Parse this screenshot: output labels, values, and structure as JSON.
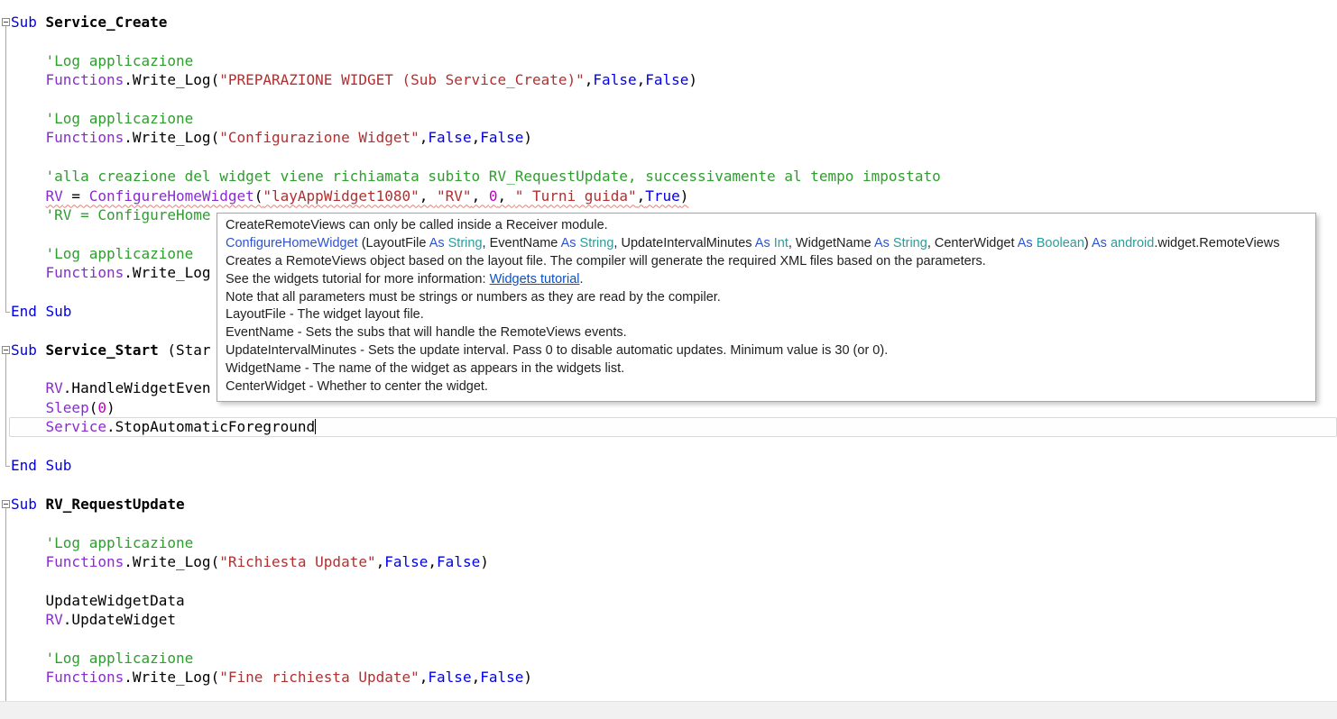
{
  "editor": {
    "syntax_colors": {
      "keyword": "#0000e8",
      "module": "#8a2bd2",
      "string": "#b03030",
      "comment": "#2e9e2e",
      "number": "#c000c0",
      "plain": "#000000",
      "squiggle": "#e97e72"
    },
    "lines": [
      {
        "segments": [
          {
            "t": "Sub ",
            "s": "k"
          },
          {
            "t": "Service_Create",
            "s": "b"
          }
        ]
      },
      {
        "segments": []
      },
      {
        "segments": [
          {
            "t": "    ",
            "s": "p"
          },
          {
            "t": "'Log applicazione",
            "s": "c"
          }
        ]
      },
      {
        "segments": [
          {
            "t": "    ",
            "s": "p"
          },
          {
            "t": "Functions",
            "s": "m"
          },
          {
            "t": ".Write_Log(",
            "s": "p"
          },
          {
            "t": "\"PREPARAZIONE WIDGET (Sub Service_Create)\"",
            "s": "s"
          },
          {
            "t": ",",
            "s": "p"
          },
          {
            "t": "False",
            "s": "k"
          },
          {
            "t": ",",
            "s": "p"
          },
          {
            "t": "False",
            "s": "k"
          },
          {
            "t": ")",
            "s": "p"
          }
        ]
      },
      {
        "segments": []
      },
      {
        "segments": [
          {
            "t": "    ",
            "s": "p"
          },
          {
            "t": "'Log applicazione",
            "s": "c"
          }
        ]
      },
      {
        "segments": [
          {
            "t": "    ",
            "s": "p"
          },
          {
            "t": "Functions",
            "s": "m"
          },
          {
            "t": ".Write_Log(",
            "s": "p"
          },
          {
            "t": "\"Configurazione Widget\"",
            "s": "s"
          },
          {
            "t": ",",
            "s": "p"
          },
          {
            "t": "False",
            "s": "k"
          },
          {
            "t": ",",
            "s": "p"
          },
          {
            "t": "False",
            "s": "k"
          },
          {
            "t": ")",
            "s": "p"
          }
        ]
      },
      {
        "segments": []
      },
      {
        "segments": [
          {
            "t": "    ",
            "s": "p"
          },
          {
            "t": "'alla creazione del widget viene richiamata subito RV_RequestUpdate, successivamente al tempo impostato",
            "s": "c"
          }
        ]
      },
      {
        "lead": "    ",
        "squiggle": true,
        "segments": [
          {
            "t": "RV",
            "s": "m"
          },
          {
            "t": " = ",
            "s": "p"
          },
          {
            "t": "ConfigureHomeWidget",
            "s": "m"
          },
          {
            "t": "(",
            "s": "p"
          },
          {
            "t": "\"layAppWidget1080\"",
            "s": "s"
          },
          {
            "t": ", ",
            "s": "p"
          },
          {
            "t": "\"RV\"",
            "s": "s"
          },
          {
            "t": ", ",
            "s": "p"
          },
          {
            "t": "0",
            "s": "n"
          },
          {
            "t": ", ",
            "s": "p"
          },
          {
            "t": "\" Turni guida\"",
            "s": "s"
          },
          {
            "t": ",",
            "s": "p"
          },
          {
            "t": "True",
            "s": "k"
          },
          {
            "t": ")",
            "s": "p"
          }
        ]
      },
      {
        "segments": [
          {
            "t": "    ",
            "s": "p"
          },
          {
            "t": "'RV = ConfigureHome",
            "s": "c"
          }
        ]
      },
      {
        "segments": []
      },
      {
        "segments": [
          {
            "t": "    ",
            "s": "p"
          },
          {
            "t": "'Log applicazione",
            "s": "c"
          }
        ]
      },
      {
        "segments": [
          {
            "t": "    ",
            "s": "p"
          },
          {
            "t": "Functions",
            "s": "m"
          },
          {
            "t": ".Write_Log",
            "s": "p"
          }
        ]
      },
      {
        "segments": []
      },
      {
        "segments": [
          {
            "t": "End Sub",
            "s": "k"
          }
        ]
      },
      {
        "segments": []
      },
      {
        "segments": [
          {
            "t": "Sub ",
            "s": "k"
          },
          {
            "t": "Service_Start ",
            "s": "b"
          },
          {
            "t": "(Star",
            "s": "p"
          }
        ]
      },
      {
        "segments": []
      },
      {
        "segments": [
          {
            "t": "    ",
            "s": "p"
          },
          {
            "t": "RV",
            "s": "m"
          },
          {
            "t": ".HandleWidgetEven",
            "s": "p"
          }
        ]
      },
      {
        "segments": [
          {
            "t": "    ",
            "s": "p"
          },
          {
            "t": "Sleep",
            "s": "m"
          },
          {
            "t": "(",
            "s": "p"
          },
          {
            "t": "0",
            "s": "n"
          },
          {
            "t": ")",
            "s": "p"
          }
        ]
      },
      {
        "current": true,
        "caret": true,
        "segments": [
          {
            "t": "    ",
            "s": "p"
          },
          {
            "t": "Service",
            "s": "m"
          },
          {
            "t": ".StopAutomaticForeground",
            "s": "p"
          }
        ]
      },
      {
        "segments": []
      },
      {
        "segments": [
          {
            "t": "End Sub",
            "s": "k"
          }
        ]
      },
      {
        "segments": []
      },
      {
        "segments": [
          {
            "t": "Sub ",
            "s": "k"
          },
          {
            "t": "RV_RequestUpdate",
            "s": "b"
          }
        ]
      },
      {
        "segments": []
      },
      {
        "segments": [
          {
            "t": "    ",
            "s": "p"
          },
          {
            "t": "'Log applicazione",
            "s": "c"
          }
        ]
      },
      {
        "segments": [
          {
            "t": "    ",
            "s": "p"
          },
          {
            "t": "Functions",
            "s": "m"
          },
          {
            "t": ".Write_Log(",
            "s": "p"
          },
          {
            "t": "\"Richiesta Update\"",
            "s": "s"
          },
          {
            "t": ",",
            "s": "p"
          },
          {
            "t": "False",
            "s": "k"
          },
          {
            "t": ",",
            "s": "p"
          },
          {
            "t": "False",
            "s": "k"
          },
          {
            "t": ")",
            "s": "p"
          }
        ]
      },
      {
        "segments": []
      },
      {
        "segments": [
          {
            "t": "    UpdateWidgetData",
            "s": "p"
          }
        ]
      },
      {
        "segments": [
          {
            "t": "    ",
            "s": "p"
          },
          {
            "t": "RV",
            "s": "m"
          },
          {
            "t": ".UpdateWidget",
            "s": "p"
          }
        ]
      },
      {
        "segments": []
      },
      {
        "segments": [
          {
            "t": "    ",
            "s": "p"
          },
          {
            "t": "'Log applicazione",
            "s": "c"
          }
        ]
      },
      {
        "segments": [
          {
            "t": "    ",
            "s": "p"
          },
          {
            "t": "Functions",
            "s": "m"
          },
          {
            "t": ".Write_Log(",
            "s": "p"
          },
          {
            "t": "\"Fine richiesta Update\"",
            "s": "s"
          },
          {
            "t": ",",
            "s": "p"
          },
          {
            "t": "False",
            "s": "k"
          },
          {
            "t": ",",
            "s": "p"
          },
          {
            "t": "False",
            "s": "k"
          },
          {
            "t": ")",
            "s": "p"
          }
        ]
      }
    ],
    "folds": [
      {
        "start": 0,
        "end": 15
      },
      {
        "start": 17,
        "end": 23
      },
      {
        "start": 25,
        "end": -1
      }
    ]
  },
  "tooltip": {
    "colors": {
      "blue": "#2d53d0",
      "teal": "#2b9c9c",
      "link": "#0b52c7"
    },
    "lines": [
      {
        "segments": [
          {
            "t": "CreateRemoteViews can only be called inside a Receiver module.",
            "s": "plain"
          }
        ]
      },
      {
        "segments": [
          {
            "t": "ConfigureHomeWidget",
            "s": "blue"
          },
          {
            "t": " (LayoutFile ",
            "s": "plain"
          },
          {
            "t": "As",
            "s": "blue"
          },
          {
            "t": " ",
            "s": "plain"
          },
          {
            "t": "String",
            "s": "teal"
          },
          {
            "t": ", EventName ",
            "s": "plain"
          },
          {
            "t": "As",
            "s": "blue"
          },
          {
            "t": " ",
            "s": "plain"
          },
          {
            "t": "String",
            "s": "teal"
          },
          {
            "t": ", UpdateIntervalMinutes ",
            "s": "plain"
          },
          {
            "t": "As",
            "s": "blue"
          },
          {
            "t": " ",
            "s": "plain"
          },
          {
            "t": "Int",
            "s": "teal"
          },
          {
            "t": ", WidgetName ",
            "s": "plain"
          },
          {
            "t": "As",
            "s": "blue"
          },
          {
            "t": " ",
            "s": "plain"
          },
          {
            "t": "String",
            "s": "teal"
          },
          {
            "t": ", CenterWidget ",
            "s": "plain"
          },
          {
            "t": "As",
            "s": "blue"
          },
          {
            "t": " ",
            "s": "plain"
          },
          {
            "t": "Boolean",
            "s": "teal"
          },
          {
            "t": ") ",
            "s": "plain"
          },
          {
            "t": "As",
            "s": "blue"
          },
          {
            "t": " ",
            "s": "plain"
          },
          {
            "t": "android",
            "s": "teal"
          },
          {
            "t": ".widget.RemoteViews",
            "s": "plain"
          }
        ]
      },
      {
        "segments": [
          {
            "t": "Creates a RemoteViews object based on the layout file. The compiler will generate the required XML files based on the parameters.",
            "s": "plain"
          }
        ]
      },
      {
        "segments": [
          {
            "t": "See the widgets tutorial for more information: ",
            "s": "plain"
          },
          {
            "t": "Widgets tutorial",
            "s": "link"
          },
          {
            "t": ".",
            "s": "plain"
          }
        ]
      },
      {
        "segments": [
          {
            "t": "Note that all parameters must be strings or numbers as they are read by the compiler.",
            "s": "plain"
          }
        ]
      },
      {
        "segments": [
          {
            "t": "LayoutFile - The widget layout file.",
            "s": "plain"
          }
        ]
      },
      {
        "segments": [
          {
            "t": "EventName - Sets the subs that will handle the RemoteViews events.",
            "s": "plain"
          }
        ]
      },
      {
        "segments": [
          {
            "t": "UpdateIntervalMinutes - Sets the update interval. Pass 0 to disable automatic updates. Minimum value is 30 (or 0).",
            "s": "plain"
          }
        ]
      },
      {
        "segments": [
          {
            "t": "WidgetName - The name of the widget as appears in the widgets list.",
            "s": "plain"
          }
        ]
      },
      {
        "segments": [
          {
            "t": "CenterWidget - Whether to center the widget.",
            "s": "plain"
          }
        ]
      }
    ]
  }
}
